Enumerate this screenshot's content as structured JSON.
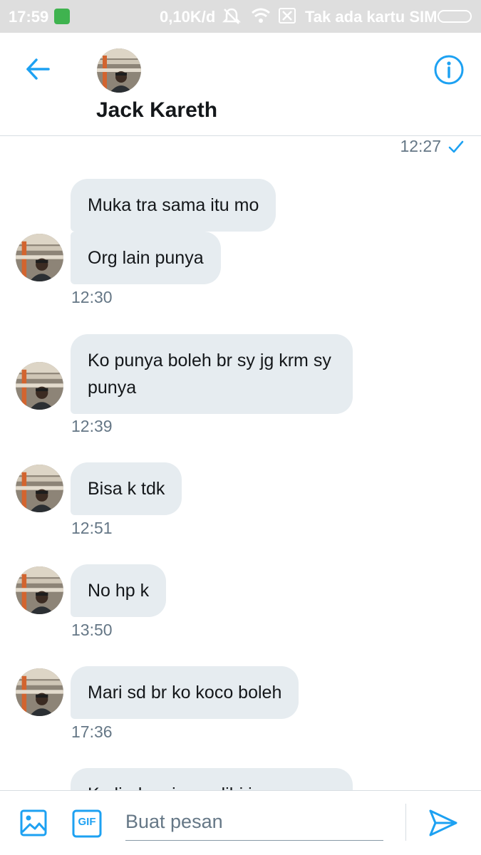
{
  "status_bar": {
    "time": "17:59",
    "network_speed": "0,10K/d",
    "sim_text": "Tak ada kartu SIM",
    "icons": [
      "app-notification-icon",
      "mute-icon",
      "wifi-icon",
      "no-sim-icon",
      "battery-icon"
    ]
  },
  "header": {
    "contact_name": "Jack Kareth",
    "back_icon": "arrow-left-icon",
    "info_icon": "info-icon",
    "accent_color": "#1da1f2"
  },
  "messages": {
    "sent_time": "12:27",
    "sent_status_icon": "check-icon",
    "group1": {
      "msg1": "Muka tra sama itu mo",
      "msg2": "Org lain punya",
      "time": "12:30"
    },
    "group2": {
      "msg": "Ko punya boleh br sy jg krm sy punya",
      "time": "12:39"
    },
    "group3": {
      "msg": "Bisa k tdk",
      "time": "12:51"
    },
    "group4": {
      "msg": "No hp k",
      "time": "13:50"
    },
    "group5": {
      "msg": "Mari sd br ko koco boleh",
      "time": "17:36"
    },
    "group6_partial": {
      "msg": "Ko liad ap in modibi in mau"
    }
  },
  "compose": {
    "placeholder": "Buat pesan",
    "gif_label": "GIF",
    "media_icon": "image-icon",
    "send_icon": "send-icon"
  }
}
